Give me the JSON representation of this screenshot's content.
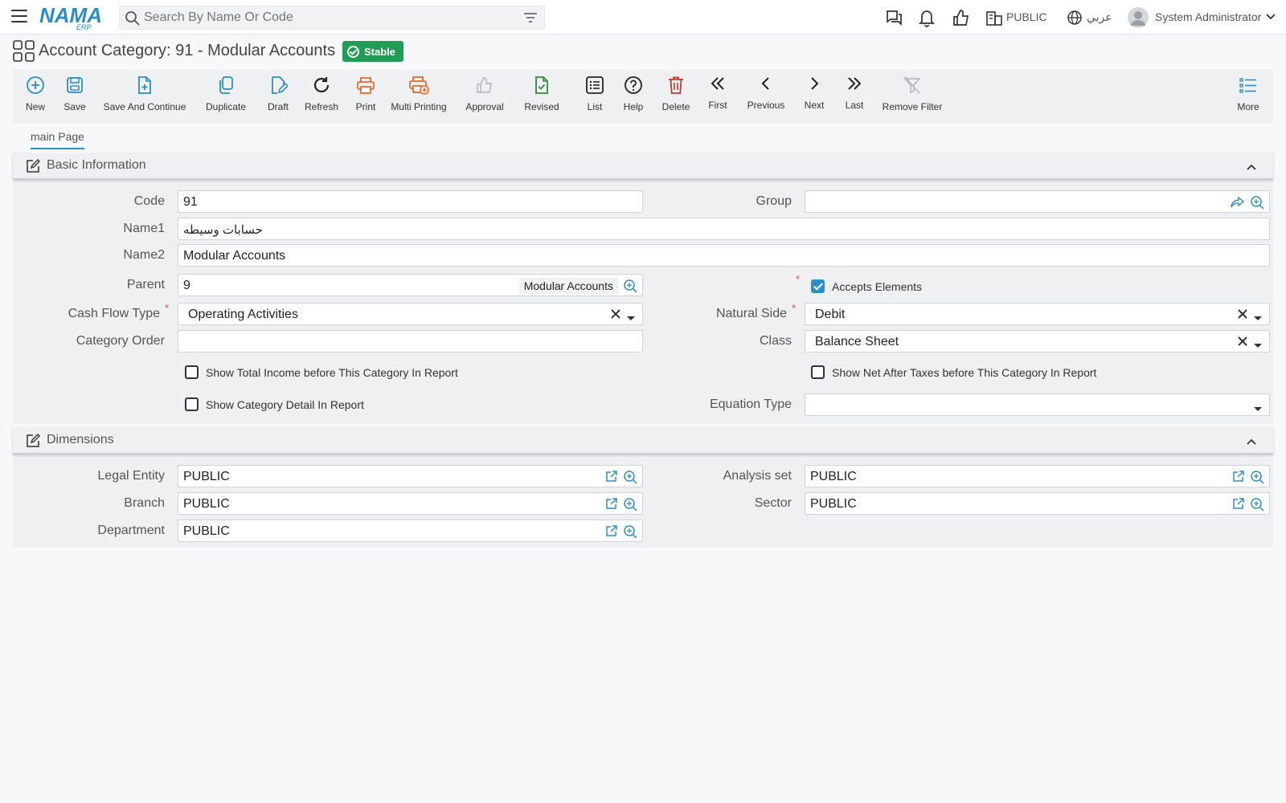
{
  "search": {
    "placeholder": "Search By Name Or Code"
  },
  "topbar": {
    "entity": "PUBLIC",
    "language": "عربي",
    "user": "System Administrator"
  },
  "page": {
    "title": "Account Category: 91 - Modular Accounts",
    "status_badge": "Stable"
  },
  "toolbar": {
    "buttons": [
      {
        "label": "New",
        "icon": "plus-circle-icon"
      },
      {
        "label": "Save",
        "icon": "save-icon"
      },
      {
        "label": "Save And Continue",
        "icon": "file-plus-icon"
      },
      {
        "label": "Duplicate",
        "icon": "duplicate-icon"
      },
      {
        "label": "Draft",
        "icon": "draft-edit-icon"
      },
      {
        "label": "Refresh",
        "icon": "refresh-icon"
      },
      {
        "label": "Print",
        "icon": "printer-icon"
      },
      {
        "label": "Multi Printing",
        "icon": "multi-printer-icon"
      },
      {
        "label": "Approval",
        "icon": "thumbs-up-icon"
      },
      {
        "label": "Revised",
        "icon": "file-check-icon"
      },
      {
        "label": "List",
        "icon": "list-icon"
      },
      {
        "label": "Help",
        "icon": "help-icon"
      },
      {
        "label": "Delete",
        "icon": "trash-icon"
      },
      {
        "label": "First",
        "icon": "double-chevron-left-icon"
      },
      {
        "label": "Previous",
        "icon": "chevron-left-icon"
      },
      {
        "label": "Next",
        "icon": "chevron-right-icon"
      },
      {
        "label": "Last",
        "icon": "double-chevron-right-icon"
      },
      {
        "label": "Remove Filter",
        "icon": "filter-off-icon"
      },
      {
        "label": "More",
        "icon": "more-list-icon"
      }
    ]
  },
  "tabs": [
    {
      "label": "main Page"
    }
  ],
  "basic_info": {
    "title": "Basic Information",
    "code": {
      "label": "Code",
      "value": "91"
    },
    "group": {
      "label": "Group",
      "value": ""
    },
    "name1": {
      "label": "Name1",
      "value": "حسابات وسيطه"
    },
    "name2": {
      "label": "Name2",
      "value": "Modular Accounts"
    },
    "parent": {
      "label": "Parent",
      "value": "9",
      "chip": "Modular Accounts"
    },
    "accepts_elements": {
      "label": "Accepts Elements",
      "checked": true
    },
    "cash_flow_type": {
      "label": "Cash Flow Type",
      "value": "Operating Activities"
    },
    "natural_side": {
      "label": "Natural Side",
      "value": "Debit"
    },
    "category_order": {
      "label": "Category Order",
      "value": ""
    },
    "class": {
      "label": "Class",
      "value": "Balance Sheet"
    },
    "show_total_income": {
      "label": "Show Total Income before This Category In Report",
      "checked": false
    },
    "show_net_after_taxes": {
      "label": "Show Net After Taxes before This Category In Report",
      "checked": false
    },
    "show_category_detail": {
      "label": "Show Category Detail In Report",
      "checked": false
    },
    "equation_type": {
      "label": "Equation Type",
      "value": ""
    }
  },
  "dimensions": {
    "title": "Dimensions",
    "legal_entity": {
      "label": "Legal Entity",
      "value": "PUBLIC"
    },
    "analysis_set": {
      "label": "Analysis set",
      "value": "PUBLIC"
    },
    "branch": {
      "label": "Branch",
      "value": "PUBLIC"
    },
    "sector": {
      "label": "Sector",
      "value": "PUBLIC"
    },
    "department": {
      "label": "Department",
      "value": "PUBLIC"
    }
  },
  "colors": {
    "accent": "#2b8fc7",
    "success": "#1f9d55",
    "print_orange": "#e8692c",
    "delete_red": "#c0392b",
    "revised_green": "#2e8b3a"
  }
}
